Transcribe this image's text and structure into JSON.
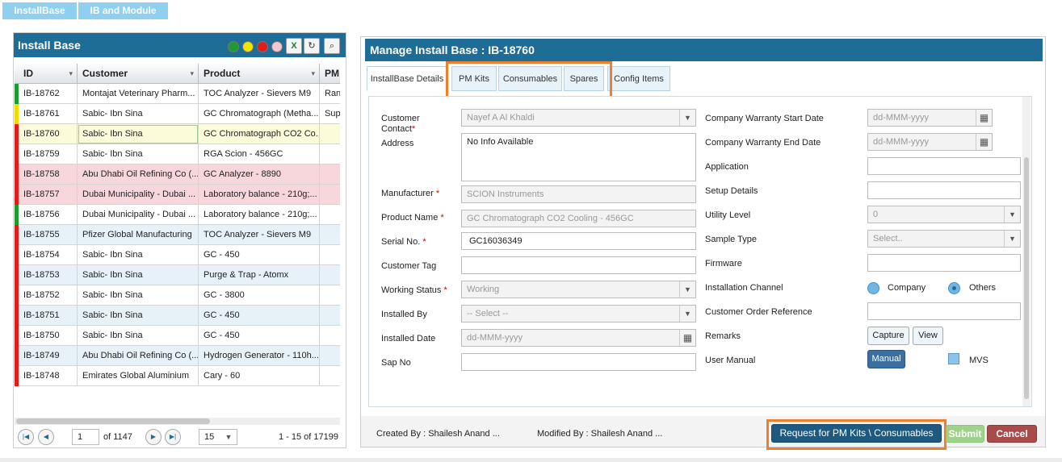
{
  "top_tabs": [
    "InstallBase",
    "IB and Module"
  ],
  "left": {
    "title": "Install Base",
    "columns": [
      "ID",
      "Customer",
      "Product",
      "PM"
    ],
    "rows": [
      {
        "id": "IB-18762",
        "customer": "Montajat Veterinary Pharm...",
        "product": "TOC Analyzer - Sievers M9",
        "pm": "Ran",
        "status": "#1f9a33",
        "bg": "#fff"
      },
      {
        "id": "IB-18761",
        "customer": "Sabic- Ibn Sina",
        "product": "GC Chromatograph (Metha...",
        "pm": "Supe",
        "status": "#f5d800",
        "bg": "#fff"
      },
      {
        "id": "IB-18760",
        "customer": "Sabic- Ibn Sina",
        "product": "GC Chromatograph CO2 Co...",
        "pm": "",
        "status": "#e21b1b",
        "bg": "#fbfbd9"
      },
      {
        "id": "IB-18759",
        "customer": "Sabic- Ibn Sina",
        "product": "RGA Scion - 456GC",
        "pm": "",
        "status": "#e21b1b",
        "bg": "#fff"
      },
      {
        "id": "IB-18758",
        "customer": "Abu Dhabi Oil Refining Co (...",
        "product": "GC Analyzer - 8890",
        "pm": "",
        "status": "#e21b1b",
        "bg": "#f7d6dc"
      },
      {
        "id": "IB-18757",
        "customer": "Dubai Municipality - Dubai ...",
        "product": "Laboratory balance - 210g;...",
        "pm": "",
        "status": "#e21b1b",
        "bg": "#f7d6dc"
      },
      {
        "id": "IB-18756",
        "customer": "Dubai Municipality - Dubai ...",
        "product": "Laboratory balance - 210g;...",
        "pm": "",
        "status": "#1f9a33",
        "bg": "#fff"
      },
      {
        "id": "IB-18755",
        "customer": "Pfizer Global Manufacturing",
        "product": "TOC Analyzer - Sievers M9",
        "pm": "",
        "status": "#e21b1b",
        "bg": "#e6f1f8"
      },
      {
        "id": "IB-18754",
        "customer": "Sabic- Ibn Sina",
        "product": "GC - 450",
        "pm": "",
        "status": "#e21b1b",
        "bg": "#fff"
      },
      {
        "id": "IB-18753",
        "customer": "Sabic- Ibn Sina",
        "product": "Purge & Trap - Atomx",
        "pm": "",
        "status": "#e21b1b",
        "bg": "#e6f1f8"
      },
      {
        "id": "IB-18752",
        "customer": "Sabic- Ibn Sina",
        "product": "GC - 3800",
        "pm": "",
        "status": "#e21b1b",
        "bg": "#fff"
      },
      {
        "id": "IB-18751",
        "customer": "Sabic- Ibn Sina",
        "product": "GC - 450",
        "pm": "",
        "status": "#e21b1b",
        "bg": "#e6f1f8"
      },
      {
        "id": "IB-18750",
        "customer": "Sabic- Ibn Sina",
        "product": "GC - 450",
        "pm": "",
        "status": "#e21b1b",
        "bg": "#fff"
      },
      {
        "id": "IB-18749",
        "customer": "Abu Dhabi Oil Refining Co (...",
        "product": "Hydrogen Generator - 110h...",
        "pm": "",
        "status": "#e21b1b",
        "bg": "#e6f1f8"
      },
      {
        "id": "IB-18748",
        "customer": "Emirates Global Aluminium",
        "product": "Cary - 60",
        "pm": "",
        "status": "#e21b1b",
        "bg": "#fff"
      }
    ],
    "pager": {
      "page": "1",
      "of": "of 1147",
      "size": "15",
      "summary": "1 - 15 of 17199"
    }
  },
  "main": {
    "title": "Manage Install Base : IB-18760",
    "tabs": [
      "InstallBase Details",
      "PM Kits",
      "Consumables",
      "Spares",
      "Config Items"
    ],
    "fields": {
      "customer_contact_label": "Customer Contact",
      "customer_contact": "Nayef A Al Khaldi",
      "address_label": "Address",
      "address": "No Info Available",
      "manufacturer_label": "Manufacturer",
      "manufacturer": "SCION Instruments",
      "product_name_label": "Product Name",
      "product_name": "GC Chromatograph CO2 Cooling - 456GC",
      "serial_label": "Serial No.",
      "serial": "GC16036349",
      "customer_tag_label": "Customer Tag",
      "working_status_label": "Working Status",
      "working_status": "Working",
      "installed_by_label": "Installed By",
      "installed_by": "-- Select --",
      "installed_date_label": "Installed Date",
      "installed_date": "dd-MMM-yyyy",
      "sap_label": "Sap No",
      "cw_start_label": "Company Warranty Start Date",
      "cw_start": "dd-MMM-yyyy",
      "cw_end_label": "Company Warranty End Date",
      "cw_end": "dd-MMM-yyyy",
      "application_label": "Application",
      "setup_label": "Setup Details",
      "utility_label": "Utility Level",
      "utility": "0",
      "sample_label": "Sample Type",
      "sample": "Select..",
      "firmware_label": "Firmware",
      "channel_label": "Installation Channel",
      "channel_opt1": "Company",
      "channel_opt2": "Others",
      "cust_order_label": "Customer Order Reference",
      "remarks_label": "Remarks",
      "capture": "Capture",
      "view": "View",
      "manual_label": "User Manual",
      "manual_btn": "Manual",
      "mvs": "MVS"
    },
    "footer": {
      "created": "Created By : Shailesh Anand ...",
      "modified": "Modified By : Shailesh Anand ...",
      "request": "Request for PM Kits \\ Consumables",
      "submit": "Submit",
      "cancel": "Cancel"
    }
  }
}
